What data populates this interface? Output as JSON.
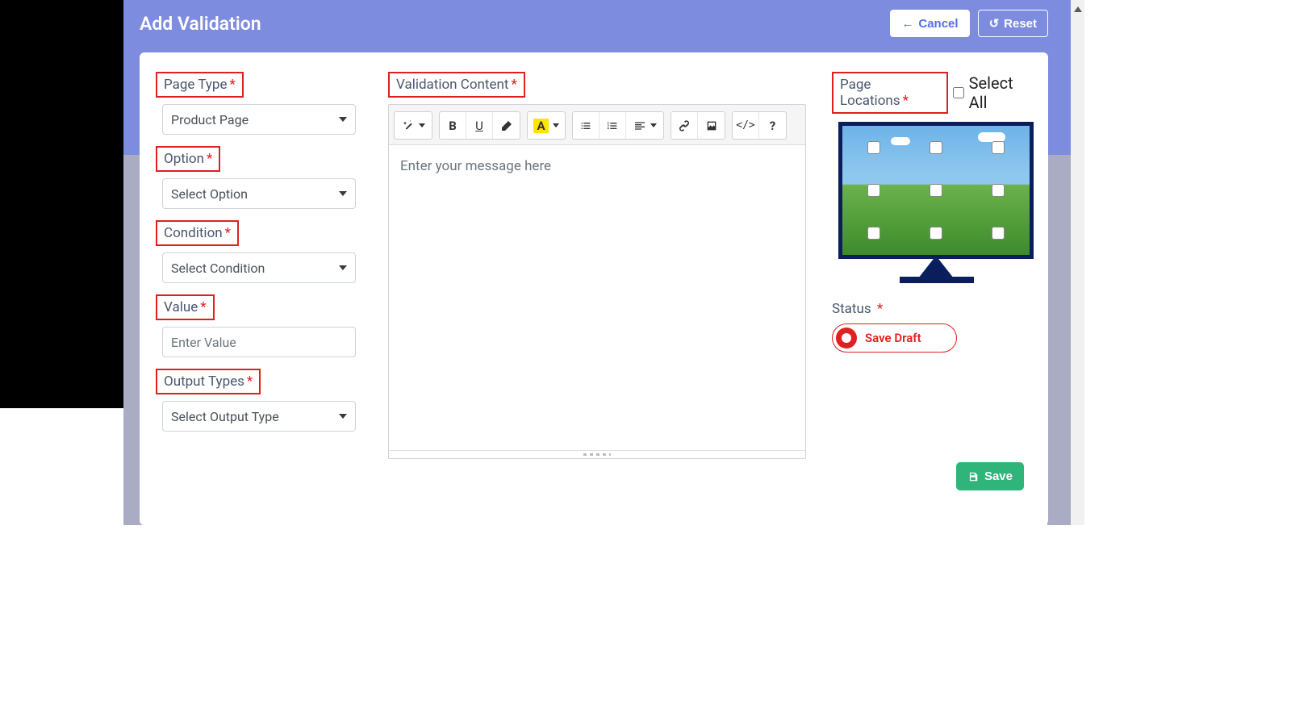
{
  "header": {
    "title": "Add Validation",
    "cancel": "Cancel",
    "reset": "Reset"
  },
  "form": {
    "page_type": {
      "label": "Page Type",
      "value": "Product Page"
    },
    "option": {
      "label": "Option",
      "value": "Select Option"
    },
    "condition": {
      "label": "Condition",
      "value": "Select Condition"
    },
    "value": {
      "label": "Value",
      "placeholder": "Enter Value"
    },
    "output_types": {
      "label": "Output Types",
      "value": "Select Output Type"
    }
  },
  "editor": {
    "label": "Validation Content",
    "placeholder": "Enter your message here"
  },
  "locations": {
    "label": "Page Locations",
    "select_all": "Select All"
  },
  "status": {
    "label": "Status",
    "option": "Save Draft"
  },
  "actions": {
    "save": "Save"
  },
  "colors": {
    "primary": "#7e8ce0",
    "danger": "#e02020",
    "success": "#2fb57a",
    "link": "#556ee6"
  }
}
